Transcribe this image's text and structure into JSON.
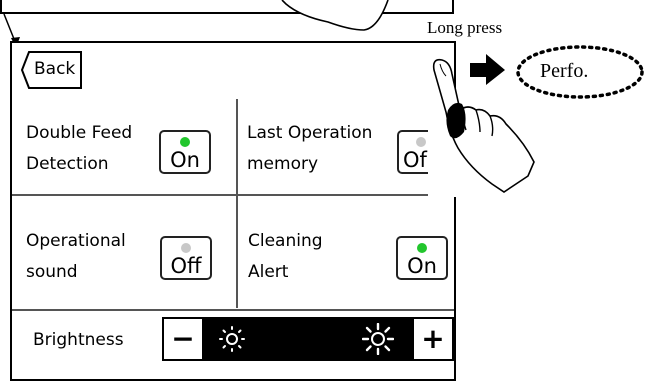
{
  "header": {
    "long_press_label": "Long press",
    "perfo_label": "Perfo."
  },
  "panel": {
    "back_label": "Back",
    "settings": [
      {
        "label_line1": "Double Feed",
        "label_line2": "Detection",
        "state": "On",
        "led": "#22c62d"
      },
      {
        "label_line1": "Last Operation",
        "label_line2": "memory",
        "state": "Of",
        "led": "#c8c8c8"
      },
      {
        "label_line1": "Operational",
        "label_line2": "sound",
        "state": "Off",
        "led": "#c8c8c8"
      },
      {
        "label_line1": "Cleaning",
        "label_line2": "Alert",
        "state": "On",
        "led": "#22c62d"
      }
    ],
    "brightness": {
      "label": "Brightness",
      "minus": "−",
      "plus": "+"
    }
  },
  "icons": [
    "back-arrow-shape",
    "sun-dim-icon",
    "sun-bright-icon",
    "pointing-hand-icon",
    "right-arrow-icon"
  ]
}
